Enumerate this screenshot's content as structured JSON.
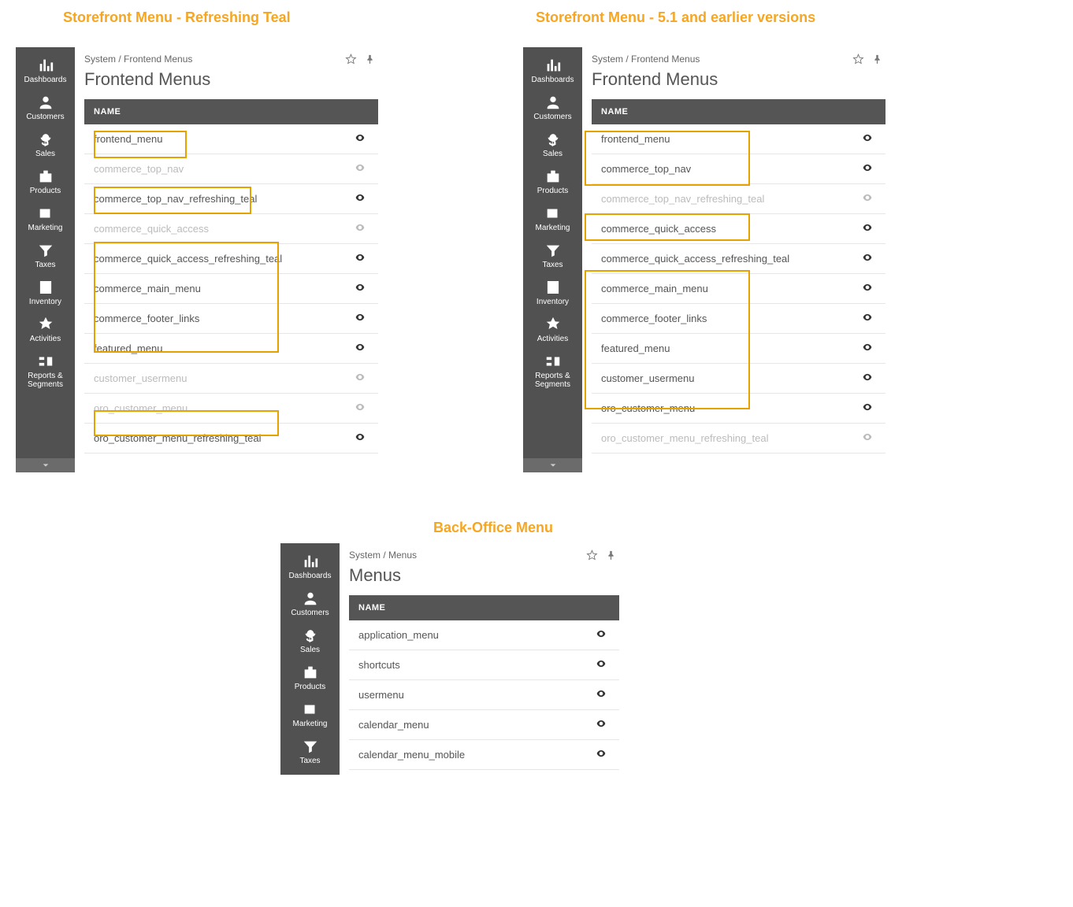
{
  "headings": {
    "left": "Storefront Menu - Refreshing Teal",
    "right": "Storefront Menu - 5.1 and earlier versions",
    "bottom": "Back-Office Menu"
  },
  "sidebar": {
    "items": [
      {
        "label": "Dashboards"
      },
      {
        "label": "Customers"
      },
      {
        "label": "Sales"
      },
      {
        "label": "Products"
      },
      {
        "label": "Marketing"
      },
      {
        "label": "Taxes"
      },
      {
        "label": "Inventory"
      },
      {
        "label": "Activities"
      },
      {
        "label": "Reports &\nSegments"
      }
    ]
  },
  "column_name": "NAME",
  "panels": {
    "left": {
      "breadcrumb": "System / Frontend Menus",
      "title": "Frontend Menus",
      "rows": [
        {
          "name": "frontend_menu",
          "muted": false
        },
        {
          "name": "commerce_top_nav",
          "muted": true
        },
        {
          "name": "commerce_top_nav_refreshing_teal",
          "muted": false
        },
        {
          "name": "commerce_quick_access",
          "muted": true
        },
        {
          "name": "commerce_quick_access_refreshing_teal",
          "muted": false
        },
        {
          "name": "commerce_main_menu",
          "muted": false
        },
        {
          "name": "commerce_footer_links",
          "muted": false
        },
        {
          "name": "featured_menu",
          "muted": false
        },
        {
          "name": "customer_usermenu",
          "muted": true
        },
        {
          "name": "oro_customer_menu",
          "muted": true
        },
        {
          "name": "oro_customer_menu_refreshing_teal",
          "muted": false
        }
      ]
    },
    "right": {
      "breadcrumb": "System / Frontend Menus",
      "title": "Frontend Menus",
      "rows": [
        {
          "name": "frontend_menu",
          "muted": false
        },
        {
          "name": "commerce_top_nav",
          "muted": false
        },
        {
          "name": "commerce_top_nav_refreshing_teal",
          "muted": true
        },
        {
          "name": "commerce_quick_access",
          "muted": false
        },
        {
          "name": "commerce_quick_access_refreshing_teal",
          "muted": false
        },
        {
          "name": "commerce_main_menu",
          "muted": false
        },
        {
          "name": "commerce_footer_links",
          "muted": false
        },
        {
          "name": "featured_menu",
          "muted": false
        },
        {
          "name": "customer_usermenu",
          "muted": false
        },
        {
          "name": "oro_customer_menu",
          "muted": false
        },
        {
          "name": "oro_customer_menu_refreshing_teal",
          "muted": true
        }
      ]
    },
    "bottom": {
      "breadcrumb": "System / Menus",
      "title": "Menus",
      "rows": [
        {
          "name": "application_menu",
          "muted": false
        },
        {
          "name": "shortcuts",
          "muted": false
        },
        {
          "name": "usermenu",
          "muted": false
        },
        {
          "name": "calendar_menu",
          "muted": false
        },
        {
          "name": "calendar_menu_mobile",
          "muted": false
        }
      ]
    }
  }
}
